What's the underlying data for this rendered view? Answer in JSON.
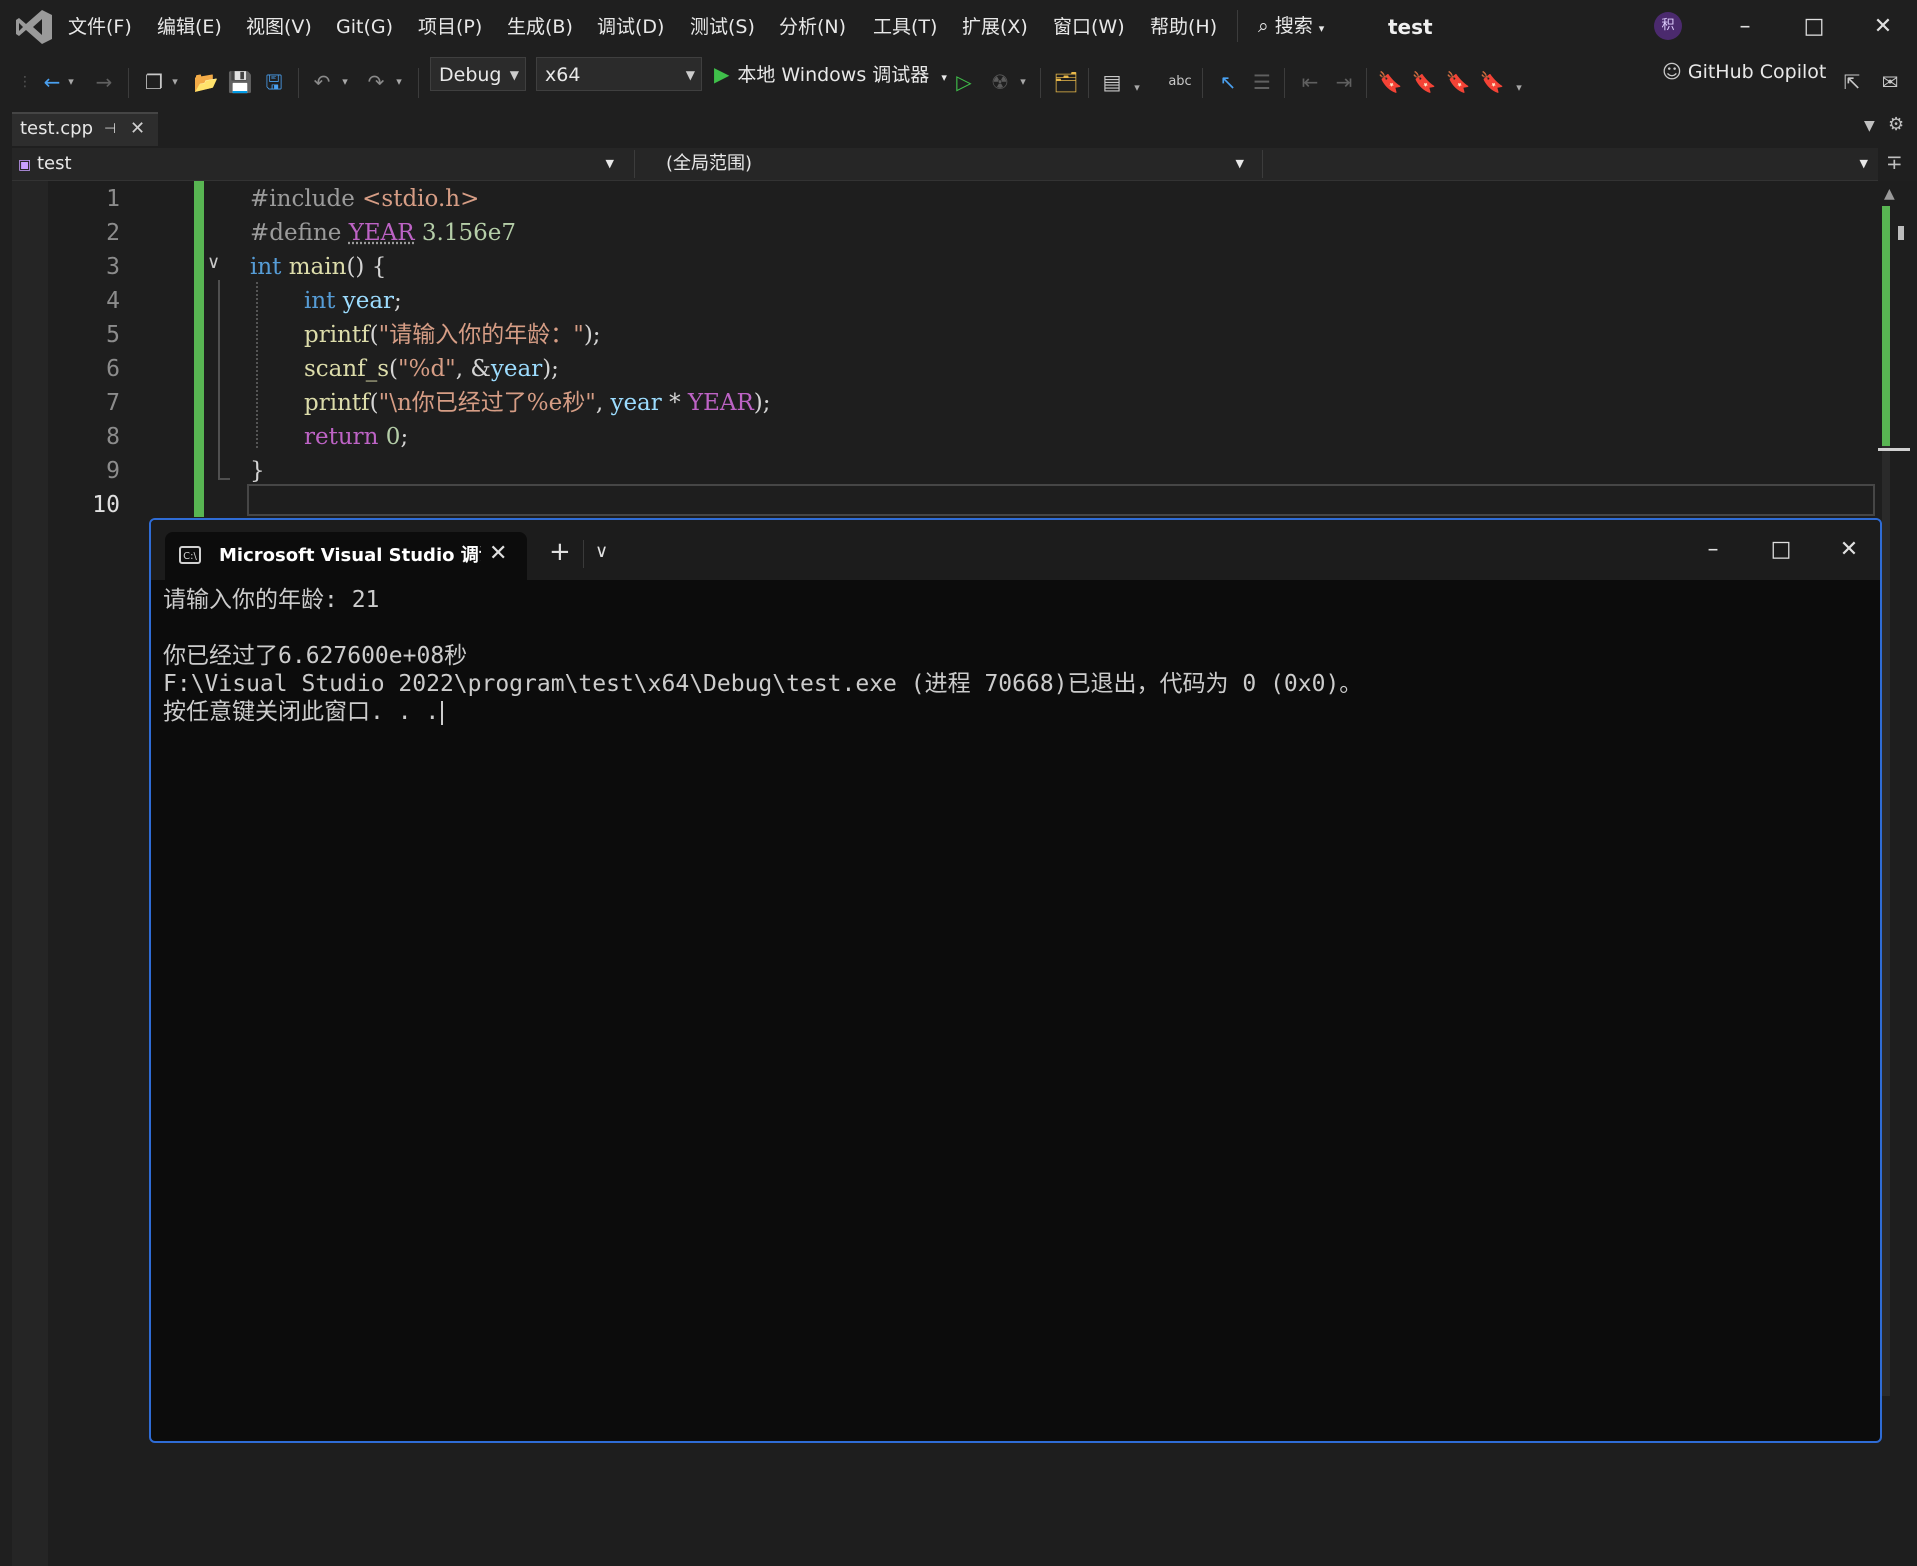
{
  "menu": {
    "items": [
      "文件(F)",
      "编辑(E)",
      "视图(V)",
      "Git(G)",
      "项目(P)",
      "生成(B)",
      "调试(D)",
      "测试(S)",
      "分析(N)",
      "工具(T)",
      "扩展(X)",
      "窗口(W)",
      "帮助(H)"
    ],
    "search_label": "搜索",
    "solution_title": "test",
    "avatar_initial": "积"
  },
  "toolbar": {
    "config": "Debug",
    "platform": "x64",
    "run_label": "本地 Windows 调试器",
    "copilot_label": "GitHub Copilot"
  },
  "editor": {
    "tab_title": "test.cpp",
    "nav_project": "test",
    "nav_scope": "(全局范围)",
    "current_line": 10,
    "line_numbers": [
      "1",
      "2",
      "3",
      "4",
      "5",
      "6",
      "7",
      "8",
      "9",
      "10"
    ],
    "code": {
      "l1_a": "#include",
      "l1_b": " <stdio.h>",
      "l2_a": "#define",
      "l2_b": "YEAR",
      "l2_c": "3.156e7",
      "l3_a": "int",
      "l3_b": "main",
      "l3_c": "() {",
      "l4_a": "int",
      "l4_b": "year",
      "l4_c": ";",
      "l5_a": "printf",
      "l5_b": "(",
      "l5_c": "\"请输入你的年龄：\"",
      "l5_d": ");",
      "l6_a": "scanf_s",
      "l6_b": "(",
      "l6_c": "\"%d\"",
      "l6_d": ", &",
      "l6_e": "year",
      "l6_f": ");",
      "l7_a": "printf",
      "l7_b": "(",
      "l7_c": "\"\\n你已经过了%e秒\"",
      "l7_d": ", ",
      "l7_e": "year",
      "l7_f": " * ",
      "l7_g": "YEAR",
      "l7_h": ");",
      "l8_a": "return",
      "l8_b": "0",
      "l8_c": ";",
      "l9_a": "}"
    }
  },
  "console": {
    "tab_title": "Microsoft Visual Studio 调试控制台",
    "lines": [
      "请输入你的年龄: 21",
      "",
      "你已经过了6.627600e+08秒",
      "F:\\Visual Studio 2022\\program\\test\\x64\\Debug\\test.exe (进程 70668)已退出，代码为 0 (0x0)。",
      "按任意键关闭此窗口. . ."
    ]
  }
}
